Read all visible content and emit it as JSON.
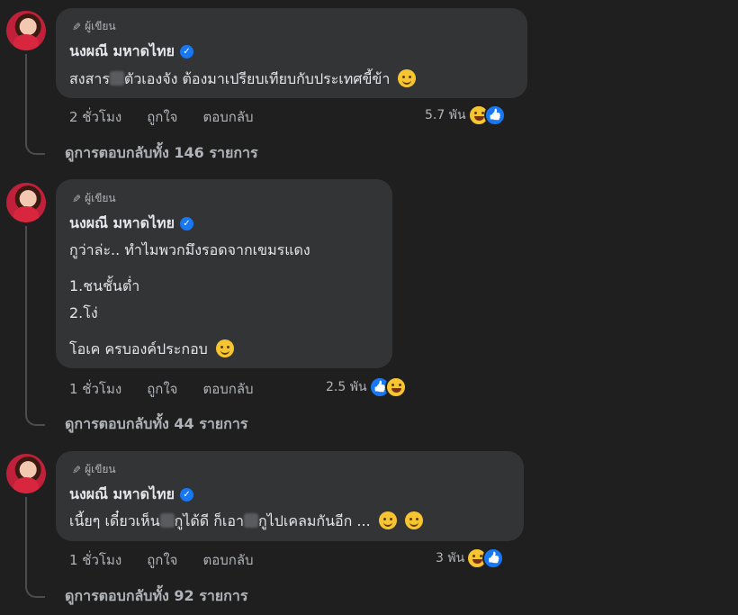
{
  "comments": [
    {
      "badge": "ผู้เขียน",
      "name": "นงผณี มหาดไทย",
      "text_a": "สงสาร",
      "text_b": "ตัวเองจัง ต้องมาเปรียบเทียบกับประเทศขี้ข้า",
      "time": "2 ชั่วโมง",
      "like": "ถูกใจ",
      "reply": "ตอบกลับ",
      "reactions": "5.7 พัน",
      "view_replies": "ดูการตอบกลับทั้ง 146 รายการ"
    },
    {
      "badge": "ผู้เขียน",
      "name": "นงผณี มหาดไทย",
      "line1": "กูว่าล่ะ.. ทำไมพวกมึงรอดจากเขมรแดง",
      "line2": "1.ชนชั้นต่ำ",
      "line3": "2.โง่",
      "line4": "โอเค ครบองค์ประกอบ",
      "time": "1 ชั่วโมง",
      "like": "ถูกใจ",
      "reply": "ตอบกลับ",
      "reactions": "2.5 พัน",
      "view_replies": "ดูการตอบกลับทั้ง 44 รายการ"
    },
    {
      "badge": "ผู้เขียน",
      "name": "นงผณี มหาดไทย",
      "text_a": "เนี้ยๆ เดี๋ยวเห็น",
      "text_b": "กูได้ดี ก็เอา",
      "text_c": "กูไปเคลมกันอีก ...",
      "time": "1 ชั่วโมง",
      "like": "ถูกใจ",
      "reply": "ตอบกลับ",
      "reactions": "3 พัน",
      "view_replies": "ดูการตอบกลับทั้ง 92 รายการ"
    }
  ],
  "colors": {
    "background": "#1f1f1f",
    "bubble": "#333436",
    "verified": "#1877f2"
  }
}
